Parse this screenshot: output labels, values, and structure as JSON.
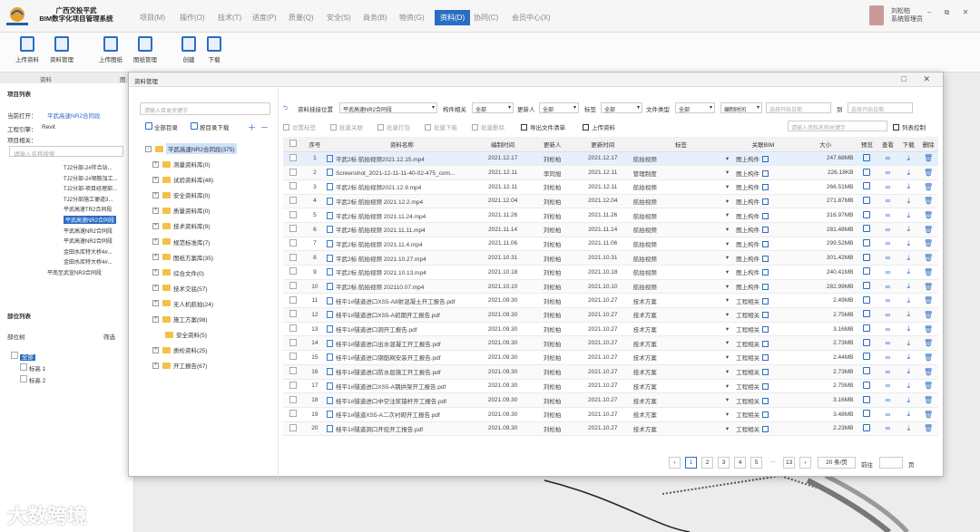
{
  "app": {
    "title_line1": "广西交投平武",
    "title_line2": "BIM数字化项目管理系统",
    "menus": [
      "项目(M)",
      "操作(O)",
      "技术(T)",
      "进度(P)",
      "质量(Q)",
      "安全(S)",
      "商务(B)",
      "物资(G)",
      "资料(D)",
      "协同(C)",
      "会员中心(X)"
    ],
    "active_menu": "资料(D)",
    "user_name": "刘松柏",
    "user_role": "系统管理员",
    "window_controls": "– ⧉ ✕"
  },
  "toolbar": {
    "buttons": [
      "上传资料",
      "资料管理",
      "上传图纸",
      "图纸管理",
      "创建",
      "下载"
    ],
    "groups": [
      "资料",
      "图"
    ]
  },
  "left_panel": {
    "project_list": "项目列表",
    "current_open_label": "当前打开：",
    "current_open_value": "平武高速NR2合同段",
    "engine_label": "工程引擎：",
    "engine_value": "Revit",
    "project_related": "项目相关：",
    "search_placeholder": "请输入名称搜索",
    "tree": [
      "TJ2分部-2#拌合站...",
      "TJ2分部-2#钢筋加工...",
      "TJ2分部-项目经理部...",
      "TJ2分部施工便道3...",
      "平武高速TR2合同段",
      "平武高速NR2合同段",
      "平武高速NR2合同段",
      "平武高速NR2合同段",
      "金田水库特大桥4#...",
      "金田水库特大桥4#...",
      "平南至武宣NR3合同段"
    ],
    "parts_list": "部位列表",
    "part_label": "部位树",
    "filter_label": "筛选",
    "part_all": "全部",
    "part_items": [
      "标高 1",
      "标高 2"
    ]
  },
  "modal": {
    "title": "资料管理",
    "controls": "□ ✕",
    "tree_search_placeholder": "请输入目录关键字",
    "all_dirs": "全部目录",
    "download_by_dir": "按目录下载",
    "root": "平武高速NR2合同段(375)",
    "folders": [
      "测量资料库(0)",
      "试验资料库(48)",
      "安全资料库(0)",
      "质量资料库(0)",
      "技术资料库(9)",
      "规范标准库(7)",
      "图纸方案库(35)",
      "综合文件(0)",
      "技术交底(57)",
      "无人机航拍(24)",
      "施工方案(98)",
      "安全资料(5)",
      "质检资料(25)",
      "开工报告(67)"
    ],
    "filters": {
      "position_label": "资料挂接位置",
      "position_value": "平武高速NR2合同段",
      "component_label": "构件相关",
      "component_value": "全部",
      "uploader_label": "更新人",
      "uploader_value": "全部",
      "tag_label": "标签",
      "tag_value": "全部",
      "file_type_label": "文件类型",
      "file_type_value": "全部",
      "time_label": "编制时间",
      "start_placeholder": "选择开始日期",
      "to_label": "到",
      "end_placeholder": "选择开始日期"
    },
    "actions": [
      "设置标签",
      "批量关联",
      "批量打包",
      "批量下载",
      "批量删除",
      "导出文件清单",
      "上传资料"
    ],
    "search_placeholder": "请输入资料名称关键字",
    "list_control": "列表控制",
    "columns": [
      "序号",
      "资料名称",
      "编制时间",
      "更新人",
      "更新时间",
      "标签",
      "关联BIM",
      "大小",
      "预览",
      "查看",
      "下载",
      "删除"
    ],
    "rows": [
      {
        "no": "1",
        "name": "平武2标 航拍视频2021.12.15.mp4",
        "date": "2021.12.17",
        "user": "刘松柏",
        "updated": "2021.12.17",
        "tag": "航拍视频",
        "bim": "图上构件",
        "size": "247.68MB"
      },
      {
        "no": "2",
        "name": "Screenshot_2021-12-11-11-40-02-475_com...",
        "date": "2021.12.11",
        "user": "李同旭",
        "updated": "2021.12.11",
        "tag": "管理制度",
        "bim": "图上构件",
        "size": "226.18KB"
      },
      {
        "no": "3",
        "name": "平武2标 航拍视频2021.12.9.mp4",
        "date": "2021.12.11",
        "user": "刘松柏",
        "updated": "2021.12.11",
        "tag": "航拍视频",
        "bim": "图上构件",
        "size": "266.51MB"
      },
      {
        "no": "4",
        "name": "平武2标 航拍视频 2021.12.2.mp4",
        "date": "2021.12.04",
        "user": "刘松柏",
        "updated": "2021.12.04",
        "tag": "航拍视频",
        "bim": "图上构件",
        "size": "271.87MB"
      },
      {
        "no": "5",
        "name": "平武2标 航拍视频 2021.11.24.mp4",
        "date": "2021.11.26",
        "user": "刘松柏",
        "updated": "2021.11.26",
        "tag": "航拍视频",
        "bim": "图上构件",
        "size": "316.97MB"
      },
      {
        "no": "6",
        "name": "平武2标 航拍视频 2021.11.11.mp4",
        "date": "2021.11.14",
        "user": "刘松柏",
        "updated": "2021.11.14",
        "tag": "航拍视频",
        "bim": "图上构件",
        "size": "281.48MB"
      },
      {
        "no": "7",
        "name": "平武2标 航拍视频 2021.11.4.mp4",
        "date": "2021.11.06",
        "user": "刘松柏",
        "updated": "2021.11.06",
        "tag": "航拍视频",
        "bim": "图上构件",
        "size": "299.52MB"
      },
      {
        "no": "8",
        "name": "平武2标 航拍视频 2021.10.27.mp4",
        "date": "2021.10.31",
        "user": "刘松柏",
        "updated": "2021.10.31",
        "tag": "航拍视频",
        "bim": "图上构件",
        "size": "301.42MB"
      },
      {
        "no": "9",
        "name": "平武2标 航拍视频 2021.10.13.mp4",
        "date": "2021.10.18",
        "user": "刘松柏",
        "updated": "2021.10.18",
        "tag": "航拍视频",
        "bim": "图上构件",
        "size": "240.41MB"
      },
      {
        "no": "10",
        "name": "平武2标 航拍视频 202110.07.mp4",
        "date": "2021.10.10",
        "user": "刘松柏",
        "updated": "2021.10.10",
        "tag": "航拍视频",
        "bim": "图上构件",
        "size": "282.99MB"
      },
      {
        "no": "11",
        "name": "桂平1#隧道进口XS5-A8射混凝土开工报告.pdf",
        "date": "2021.09.30",
        "user": "刘松柏",
        "updated": "2021.10.27",
        "tag": "技术方案",
        "bim": "工程相关",
        "size": "2.49MB"
      },
      {
        "no": "12",
        "name": "桂平1#隧道进口XS5-A初期开工报告.pdf",
        "date": "2021.09.30",
        "user": "刘松柏",
        "updated": "2021.10.27",
        "tag": "技术方案",
        "bim": "工程相关",
        "size": "2.75MB"
      },
      {
        "no": "13",
        "name": "桂平1#隧道进口洞开工报告.pdf",
        "date": "2021.09.30",
        "user": "刘松柏",
        "updated": "2021.10.27",
        "tag": "技术方案",
        "bim": "工程相关",
        "size": "3.16MB"
      },
      {
        "no": "14",
        "name": "桂平1#隧道进口出水混凝工开工报告.pdf",
        "date": "2021.09.30",
        "user": "刘松柏",
        "updated": "2021.10.27",
        "tag": "技术方案",
        "bim": "工程相关",
        "size": "2.73MB"
      },
      {
        "no": "15",
        "name": "桂平1#隧道进口钢筋网安装开工报告.pdf",
        "date": "2021.09.30",
        "user": "刘松柏",
        "updated": "2021.10.27",
        "tag": "技术方案",
        "bim": "工程相关",
        "size": "2.44MB"
      },
      {
        "no": "16",
        "name": "桂平1#隧道进口防水层施工开工报告.pdf",
        "date": "2021.09.30",
        "user": "刘松柏",
        "updated": "2021.10.27",
        "tag": "技术方案",
        "bim": "工程相关",
        "size": "2.73MB"
      },
      {
        "no": "17",
        "name": "桂平1#隧道进口XS5-A钢拱架开工报告.pdf",
        "date": "2021.09.30",
        "user": "刘松柏",
        "updated": "2021.10.27",
        "tag": "技术方案",
        "bim": "工程相关",
        "size": "2.75MB"
      },
      {
        "no": "18",
        "name": "桂平1#隧道进口中空注浆锚杆开工报告.pdf",
        "date": "2021.09.30",
        "user": "刘松柏",
        "updated": "2021.10.27",
        "tag": "技术方案",
        "bim": "工程相关",
        "size": "3.16MB"
      },
      {
        "no": "19",
        "name": "桂平1#隧道XS5-A二次衬砌开工报告.pdf",
        "date": "2021.09.30",
        "user": "刘松柏",
        "updated": "2021.10.27",
        "tag": "技术方案",
        "bim": "工程相关",
        "size": "3.48MB"
      },
      {
        "no": "20",
        "name": "桂平1#隧道洞口开挖开工报告.pdf",
        "date": "2021.09.30",
        "user": "刘松柏",
        "updated": "2021.10.27",
        "tag": "技术方案",
        "bim": "工程相关",
        "size": "2.23MB"
      }
    ],
    "pager": {
      "pages": [
        "1",
        "2",
        "3",
        "4",
        "5",
        "···",
        "13"
      ],
      "current": "1",
      "page_size": "20 条/页",
      "goto": "前往",
      "goto_suffix": "页"
    }
  },
  "watermark": "大数跨境",
  "colors": {
    "accent": "#2b6cc4",
    "selected_row": "#e6f0fc"
  }
}
